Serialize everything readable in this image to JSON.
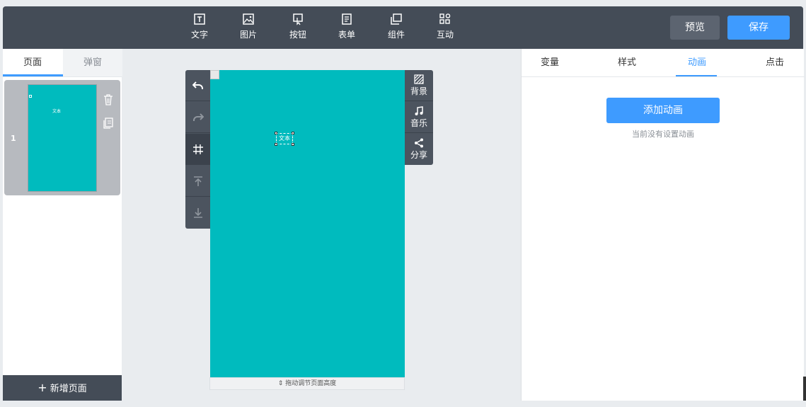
{
  "toolbar": {
    "items": [
      {
        "label": "文字",
        "icon": "text-icon"
      },
      {
        "label": "图片",
        "icon": "image-icon"
      },
      {
        "label": "按钮",
        "icon": "button-icon"
      },
      {
        "label": "表单",
        "icon": "form-icon"
      },
      {
        "label": "组件",
        "icon": "component-icon"
      },
      {
        "label": "互动",
        "icon": "interaction-icon"
      }
    ],
    "preview_label": "预览",
    "save_label": "保存"
  },
  "left_panel": {
    "tabs": [
      {
        "label": "页面",
        "active": true
      },
      {
        "label": "弹窗",
        "active": false
      }
    ],
    "pages": [
      {
        "number": "1",
        "thumb_text": "文本"
      }
    ],
    "add_page_label": "新增页面"
  },
  "canvas": {
    "background": "#00bbbe",
    "text_element": "文本",
    "resize_hint": "拖动调节页面高度",
    "side_tools": [
      {
        "label": "背景",
        "icon": "background-icon"
      },
      {
        "label": "音乐",
        "icon": "music-icon"
      },
      {
        "label": "分享",
        "icon": "share-icon"
      }
    ]
  },
  "right_panel": {
    "tabs": [
      {
        "label": "变量",
        "active": false
      },
      {
        "label": "样式",
        "active": false
      },
      {
        "label": "动画",
        "active": true
      },
      {
        "label": "点击",
        "active": false
      }
    ],
    "add_animation_label": "添加动画",
    "no_animation_text": "当前没有设置动画"
  },
  "colors": {
    "accent": "#3e9bff",
    "toolbar": "#444c57",
    "canvas": "#00bbbe"
  }
}
